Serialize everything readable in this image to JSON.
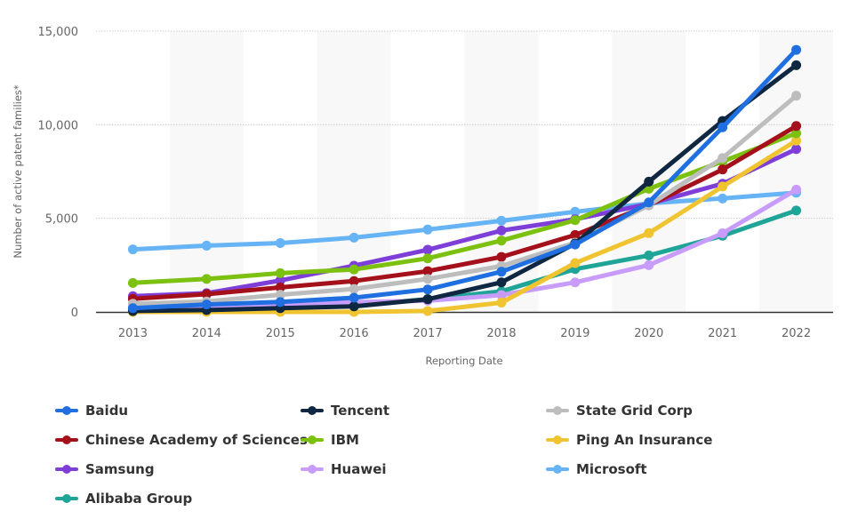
{
  "chart_data": {
    "type": "line",
    "title": "",
    "xlabel": "Reporting Date",
    "ylabel": "Number of active patent families*",
    "x": [
      "2013",
      "2014",
      "2015",
      "2016",
      "2017",
      "2018",
      "2019",
      "2020",
      "2021",
      "2022"
    ],
    "ylim": [
      0,
      15000
    ],
    "yticks": [
      0,
      5000,
      10000,
      15000
    ],
    "ytick_labels": [
      "0",
      "5,000",
      "10,000",
      "15,000"
    ],
    "grid": true,
    "legend_position": "bottom",
    "series": [
      {
        "name": "Baidu",
        "color": "#1f6fe0",
        "values": [
          200,
          400,
          530,
          760,
          1200,
          2150,
          3600,
          5850,
          9860,
          14000
        ]
      },
      {
        "name": "Tencent",
        "color": "#0f2740",
        "values": [
          50,
          100,
          200,
          300,
          680,
          1580,
          3650,
          6960,
          10200,
          13180
        ]
      },
      {
        "name": "State Grid Corp",
        "color": "#bdbdbd",
        "values": [
          440,
          560,
          920,
          1230,
          1760,
          2450,
          3700,
          5700,
          8220,
          11550
        ]
      },
      {
        "name": "Chinese Academy of Sciences",
        "color": "#a4111b",
        "values": [
          700,
          950,
          1310,
          1650,
          2180,
          2940,
          4110,
          5700,
          7610,
          9930
        ]
      },
      {
        "name": "IBM",
        "color": "#7cc110",
        "values": [
          1550,
          1760,
          2070,
          2270,
          2860,
          3810,
          4900,
          6580,
          8040,
          9540
        ]
      },
      {
        "name": "Ping An Insurance",
        "color": "#f0c430",
        "values": [
          0,
          0,
          0,
          0,
          50,
          500,
          2610,
          4210,
          6700,
          9150
        ]
      },
      {
        "name": "Samsung",
        "color": "#7e3fd9",
        "values": [
          840,
          1000,
          1680,
          2470,
          3320,
          4350,
          4950,
          5770,
          6850,
          8700
        ]
      },
      {
        "name": "Huawei",
        "color": "#c79cfa",
        "values": [
          280,
          300,
          400,
          520,
          600,
          900,
          1580,
          2500,
          4200,
          6530
        ]
      },
      {
        "name": "Microsoft",
        "color": "#66b3f5",
        "values": [
          3340,
          3540,
          3680,
          3970,
          4400,
          4870,
          5350,
          5800,
          6060,
          6370
        ]
      },
      {
        "name": "Alibaba Group",
        "color": "#1fa597",
        "values": [
          130,
          200,
          280,
          370,
          680,
          1100,
          2290,
          3020,
          4070,
          5420
        ]
      }
    ]
  },
  "legend": {
    "items": [
      {
        "label": "Baidu",
        "color": "#1f6fe0"
      },
      {
        "label": "Tencent",
        "color": "#0f2740"
      },
      {
        "label": "State Grid Corp",
        "color": "#bdbdbd"
      },
      {
        "label": "Chinese Academy of Sciences",
        "color": "#a4111b"
      },
      {
        "label": "IBM",
        "color": "#7cc110"
      },
      {
        "label": "Ping An Insurance",
        "color": "#f0c430"
      },
      {
        "label": "Samsung",
        "color": "#7e3fd9"
      },
      {
        "label": "Huawei",
        "color": "#c79cfa"
      },
      {
        "label": "Microsoft",
        "color": "#66b3f5"
      },
      {
        "label": "Alibaba Group",
        "color": "#1fa597"
      }
    ]
  }
}
